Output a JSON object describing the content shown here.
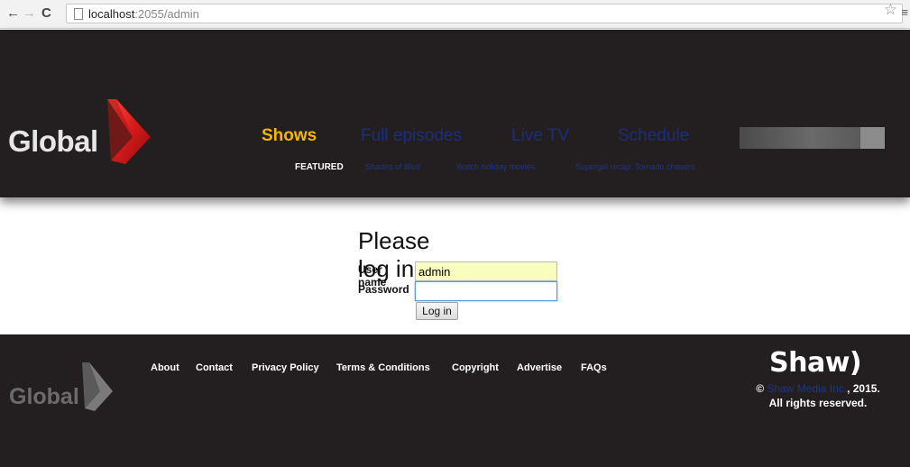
{
  "browser": {
    "url_host": "localhost",
    "url_rest": ":2055/admin",
    "back_icon": "←",
    "forward_icon": "→",
    "reload_icon": "C",
    "star_icon": "☆",
    "menu_icon": "≡"
  },
  "header": {
    "logo_text": "Global",
    "main_nav": [
      {
        "label": "Shows",
        "active": true
      },
      {
        "label": "Full episodes",
        "active": false
      },
      {
        "label": "Live TV",
        "active": false
      },
      {
        "label": "Schedule",
        "active": false
      }
    ],
    "sub_nav": {
      "featured_label": "FEATURED",
      "links": [
        "Shades of Blue",
        "Watch holiday movies",
        "Supergirl recap: Tornado chasers"
      ]
    }
  },
  "login": {
    "title": "Please log in.",
    "username_label": "User name",
    "username_value": "admin",
    "password_label": "Password",
    "password_value": "",
    "submit_label": "Log in"
  },
  "footer": {
    "logo_text": "Global",
    "links": [
      "About",
      "Contact",
      "Privacy Policy",
      "Terms & Conditions",
      "Copyright",
      "Advertise",
      "FAQs"
    ],
    "brand": "Shaw)",
    "copyright_symbol": "©",
    "company": "Shaw Media Inc.",
    "year": ", 2015.",
    "rights": "All rights reserved."
  },
  "colors": {
    "header_bg": "#231f20",
    "active_nav": "#f4b800",
    "link_blue": "#1b2e7e",
    "logo_red": "#d21f1f"
  }
}
